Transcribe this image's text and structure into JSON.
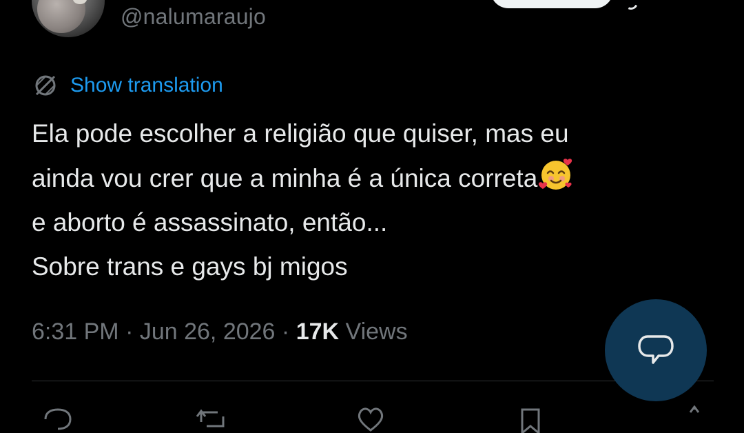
{
  "user": {
    "handle": "@nalumaraujo"
  },
  "translate": {
    "label": "Show translation",
    "icon": "translate-globe-icon"
  },
  "tweet": {
    "lines": [
      "Ela pode escolher a religião que quiser, mas eu",
      "ainda vou crer que a minha é a única correta",
      "e aborto é assassinato, então...",
      "Sobre trans e gays bj migos"
    ],
    "emoji": "smiling-face-with-hearts"
  },
  "meta": {
    "time": "6:31 PM",
    "sep1": " · ",
    "date": "Jun 26, 2026",
    "sep2": " · ",
    "views_count": "17K",
    "views_label": " Views"
  },
  "colors": {
    "background": "#000000",
    "text": "#e7e9ea",
    "secondary": "#71767b",
    "link": "#1d9bf0",
    "fab": "#0f3754"
  },
  "actions": [
    "reply-icon",
    "retweet-icon",
    "like-icon",
    "bookmark-icon",
    "share-icon"
  ]
}
